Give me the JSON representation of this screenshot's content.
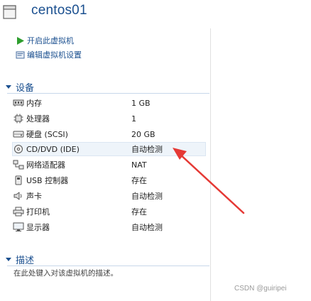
{
  "window": {
    "title": "centos01"
  },
  "actions": [
    {
      "label": "开启此虚拟机",
      "icon": "play-icon"
    },
    {
      "label": "编辑虚拟机设置",
      "icon": "edit-settings-icon"
    }
  ],
  "devices": {
    "heading": "设备",
    "items": [
      {
        "name": "内存",
        "value": "1 GB",
        "icon": "memory-icon"
      },
      {
        "name": "处理器",
        "value": "1",
        "icon": "cpu-icon"
      },
      {
        "name": "硬盘 (SCSI)",
        "value": "20 GB",
        "icon": "hard-disk-icon"
      },
      {
        "name": "CD/DVD (IDE)",
        "value": "自动检测",
        "icon": "cd-dvd-icon",
        "selected": true
      },
      {
        "name": "网络适配器",
        "value": "NAT",
        "icon": "network-adapter-icon"
      },
      {
        "name": "USB 控制器",
        "value": "存在",
        "icon": "usb-icon"
      },
      {
        "name": "声卡",
        "value": "自动检测",
        "icon": "sound-card-icon"
      },
      {
        "name": "打印机",
        "value": "存在",
        "icon": "printer-icon"
      },
      {
        "name": "显示器",
        "value": "自动检测",
        "icon": "display-icon"
      }
    ]
  },
  "description": {
    "heading": "描述",
    "placeholder": "在此处键入对该虚拟机的描述。"
  },
  "watermark": "CSDN @guiripei",
  "colors": {
    "accent": "#1a4f8f",
    "annotation_arrow": "#e53935",
    "selected_row": "#eef4fa"
  }
}
